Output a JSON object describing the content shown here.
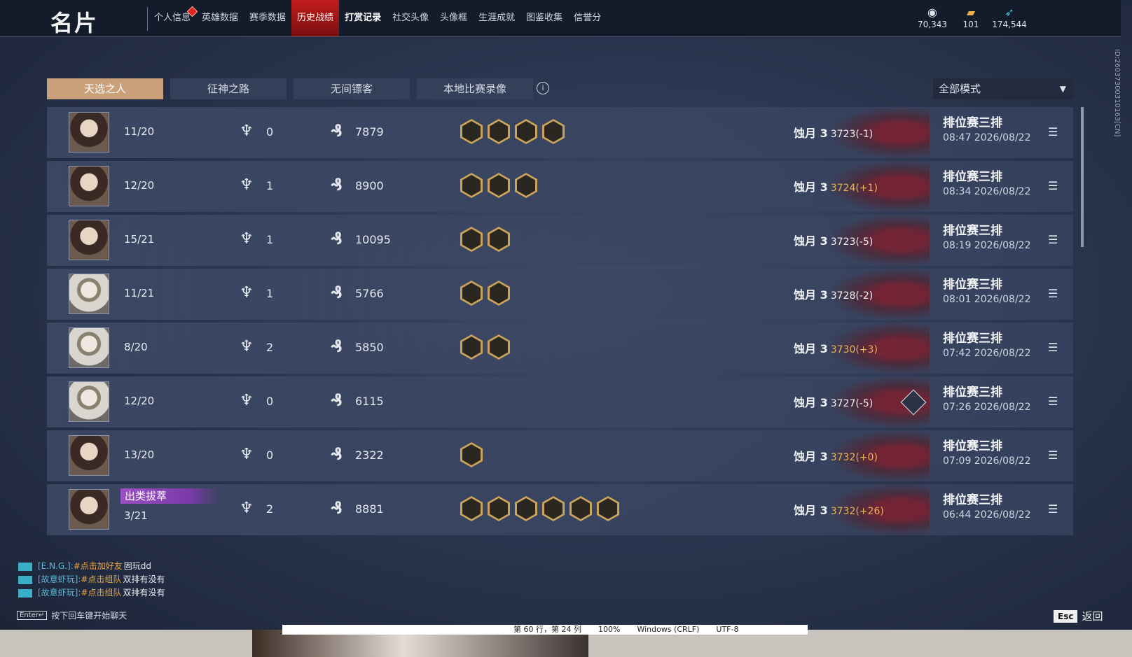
{
  "header": {
    "title": "名片",
    "nav": [
      {
        "label": "个人信息",
        "dot": true
      },
      {
        "label": "英雄数据"
      },
      {
        "label": "赛季数据"
      },
      {
        "label": "历史战绩",
        "active": true
      },
      {
        "label": "打赏记录",
        "bold": true
      },
      {
        "label": "社交头像"
      },
      {
        "label": "头像框"
      },
      {
        "label": "生涯成就"
      },
      {
        "label": "图鉴收集"
      },
      {
        "label": "信誉分"
      }
    ],
    "currencies": [
      {
        "icon": "coin-stack-icon",
        "value": "70,343"
      },
      {
        "icon": "ticket-icon",
        "value": "101"
      },
      {
        "icon": "feather-gem-icon",
        "value": "174,544"
      }
    ]
  },
  "side_id": "ID:2603730031016З[CN]",
  "tabs": [
    "天选之人",
    "征神之路",
    "无间镖客",
    "本地比赛录像"
  ],
  "mode_select": "全部模式",
  "matches": [
    {
      "avatar": "portrait",
      "kda": "11/20",
      "trophies": "0",
      "coins": "7879",
      "achievements": 4,
      "rank": "蚀月 3",
      "score": "3723(-1)",
      "gain": false,
      "type": "排位赛三排",
      "time": "08:47 2026/08/22"
    },
    {
      "avatar": "portrait",
      "kda": "12/20",
      "trophies": "1",
      "coins": "8900",
      "achievements": 3,
      "rank": "蚀月 3",
      "score": "3724(+1)",
      "gain": true,
      "type": "排位赛三排",
      "time": "08:34 2026/08/22"
    },
    {
      "avatar": "portrait",
      "kda": "15/21",
      "trophies": "1",
      "coins": "10095",
      "achievements": 2,
      "rank": "蚀月 3",
      "score": "3723(-5)",
      "gain": false,
      "type": "排位赛三排",
      "time": "08:19 2026/08/22"
    },
    {
      "avatar": "masked",
      "kda": "11/21",
      "trophies": "1",
      "coins": "5766",
      "achievements": 2,
      "rank": "蚀月 3",
      "score": "3728(-2)",
      "gain": false,
      "type": "排位赛三排",
      "time": "08:01 2026/08/22"
    },
    {
      "avatar": "masked",
      "kda": "8/20",
      "trophies": "2",
      "coins": "5850",
      "achievements": 2,
      "rank": "蚀月 3",
      "score": "3730(+3)",
      "gain": true,
      "type": "排位赛三排",
      "time": "07:42 2026/08/22"
    },
    {
      "avatar": "masked",
      "kda": "12/20",
      "trophies": "0",
      "coins": "6115",
      "achievements": 0,
      "rank": "蚀月 3",
      "score": "3727(-5)",
      "gain": false,
      "type": "排位赛三排",
      "time": "07:26 2026/08/22",
      "stats_icon": true
    },
    {
      "avatar": "portrait",
      "kda": "13/20",
      "trophies": "0",
      "coins": "2322",
      "achievements": 1,
      "rank": "蚀月 3",
      "score": "3732(+0)",
      "gain": true,
      "type": "排位赛三排",
      "time": "07:09 2026/08/22"
    },
    {
      "avatar": "portrait",
      "kda": "3/21",
      "badge": "出类拔萃",
      "trophies": "2",
      "coins": "8881",
      "achievements": 6,
      "rank": "蚀月 3",
      "score": "3732(+26)",
      "gain": true,
      "type": "排位赛三排",
      "time": "06:44 2026/08/22"
    }
  ],
  "chat": {
    "lines": [
      {
        "channel": "[E.N.G.]:",
        "link": "#点击加好友",
        "msg": "固玩dd"
      },
      {
        "channel": "[故意虾玩]:",
        "link": "#点击组队",
        "msg": "双排有没有"
      },
      {
        "channel": "[故意虾玩]:",
        "link": "#点击组队",
        "msg": "双排有没有"
      }
    ],
    "enter_key": "Enter↵",
    "hint": "按下回车键开始聊天"
  },
  "esc": {
    "key": "Esc",
    "label": "返回"
  },
  "editor_status": [
    "第 60 行，第 24 列",
    "100%",
    "Windows (CRLF)",
    "UTF-8"
  ]
}
